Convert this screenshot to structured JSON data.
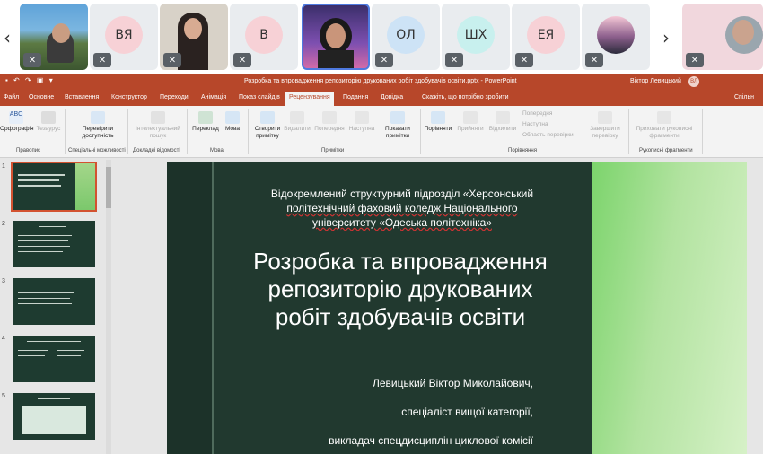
{
  "meeting": {
    "participants": [
      {
        "initials": "",
        "type": "photo"
      },
      {
        "initials": "ВЯ",
        "color": "#f7d1d6"
      },
      {
        "initials": "",
        "type": "photo"
      },
      {
        "initials": "В",
        "color": "#f7d1d6"
      },
      {
        "initials": "",
        "type": "photo"
      },
      {
        "initials": "ОЛ",
        "color": "#cde3f6"
      },
      {
        "initials": "ШХ",
        "color": "#c8f0ee"
      },
      {
        "initials": "ЕЯ",
        "color": "#f7d1d6"
      },
      {
        "initials": "",
        "type": "photo"
      },
      {
        "initials": "",
        "type": "photo"
      }
    ]
  },
  "powerpoint": {
    "window_title": "Розробка та впровадження репозиторію друкованих робіт здобувачів освіти.pptx  -  PowerPoint",
    "user_name": "Віктор Левицький",
    "user_initials": "ВЛ",
    "tabs": [
      "Файл",
      "Основне",
      "Вставлення",
      "Конструктор",
      "Переходи",
      "Анімація",
      "Показ слайдів",
      "Рецензування",
      "Подання",
      "Довідка",
      "Скажіть, що потрібно зробити",
      "Спільн"
    ],
    "active_tab": "Рецензування",
    "ribbon": {
      "spelling": "Орфографія",
      "thesaurus": "Тезаурус",
      "check_access": "Перевірити доступність",
      "smart_lookup": "Інтелектуальний пошук",
      "translate": "Переклад",
      "language": "Мова",
      "new_comment": "Створити примітку",
      "delete": "Видалити",
      "previous": "Попередня",
      "next": "Наступна",
      "show_comments": "Показати примітки",
      "compare": "Порівняти",
      "accept": "Прийняти",
      "reject": "Відхилити",
      "prev_change": "Попередня",
      "next_change": "Наступна",
      "reviewing_pane": "Область перевірки",
      "end_review": "Завершити перевірку",
      "hide_ink": "Приховати рукописні фрагменти",
      "groups": [
        "Правопис",
        "Спеціальні можливості",
        "Докладні відомості",
        "Мова",
        "Примітки",
        "Порівняння",
        "Рукописні фрагменти"
      ]
    },
    "slide_numbers": [
      "1",
      "2",
      "3",
      "4",
      "5"
    ],
    "slide": {
      "subtitle_line1": "Відокремлений структурний підрозділ «Херсонський",
      "subtitle_line2": "політехнічний фаховий коледж Національного",
      "subtitle_line3": "університету «Одеська політехніка»",
      "title_line1": "Розробка та впровадження",
      "title_line2": "репозиторію друкованих",
      "title_line3": "робіт здобувачів освіти",
      "author_name": "Левицький Віктор Миколайович,",
      "author_role": "спеціаліст вищої категорії,",
      "author_job": "викладач спецдисциплін циклової комісії"
    }
  }
}
